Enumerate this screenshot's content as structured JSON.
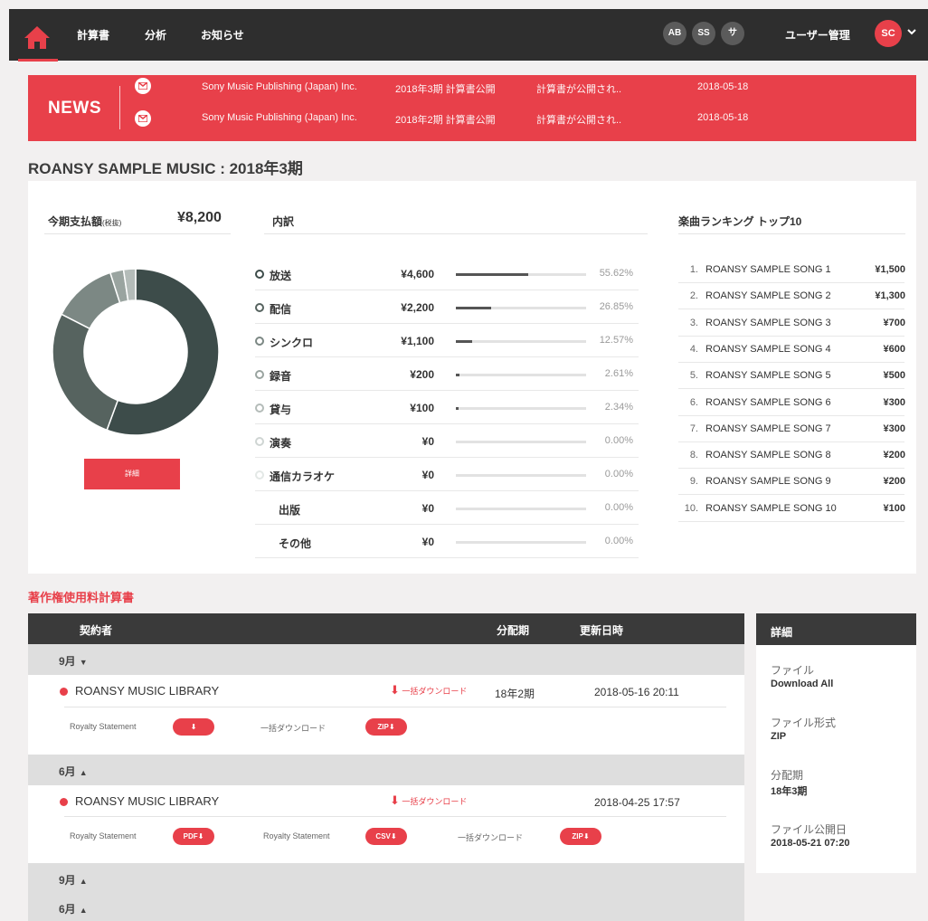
{
  "nav": {
    "items": [
      "計算書",
      "分析",
      "お知らせ"
    ],
    "avatars": [
      "AB",
      "SS",
      "サ"
    ],
    "user_management": "ユーザー管理",
    "user_initials": "SC"
  },
  "news": {
    "title": "NEWS",
    "items": [
      {
        "publisher": "Sony Music Publishing (Japan) Inc.",
        "event": "2018年3期 計算書公開",
        "message": "計算書が公開され..",
        "date": "2018-05-18"
      },
      {
        "publisher": "Sony Music Publishing (Japan) Inc.",
        "event": "2018年2期 計算書公開",
        "message": "計算書が公開され..",
        "date": "2018-05-18"
      }
    ]
  },
  "page_title": "ROANSY SAMPLE MUSIC : 2018年3期",
  "summary": {
    "payment_label": "今期支払額",
    "payment_tax_note": "(税抜)",
    "payment_amount": "¥8,200",
    "detail_button": "詳細",
    "breakdown_title": "内訳",
    "breakdown": [
      {
        "name": "放送",
        "amount": "¥4,600",
        "pct": "55.62%",
        "fraction": 0.5562,
        "color": "#3d4c4a"
      },
      {
        "name": "配信",
        "amount": "¥2,200",
        "pct": "26.85%",
        "fraction": 0.2685,
        "color": "#56635f"
      },
      {
        "name": "シンクロ",
        "amount": "¥1,100",
        "pct": "12.57%",
        "fraction": 0.1257,
        "color": "#7c8884"
      },
      {
        "name": "録音",
        "amount": "¥200",
        "pct": "2.61%",
        "fraction": 0.0261,
        "color": "#9aa4a0"
      },
      {
        "name": "貸与",
        "amount": "¥100",
        "pct": "2.34%",
        "fraction": 0.0234,
        "color": "#b4bcb9"
      },
      {
        "name": "演奏",
        "amount": "¥0",
        "pct": "0.00%",
        "fraction": 0,
        "color": "#cfd5d3"
      },
      {
        "name": "通信カラオケ",
        "amount": "¥0",
        "pct": "0.00%",
        "fraction": 0,
        "color": "#e3e8e6"
      },
      {
        "name": "出版",
        "amount": "¥0",
        "pct": "0.00%",
        "fraction": 0,
        "color": ""
      },
      {
        "name": "その他",
        "amount": "¥0",
        "pct": "0.00%",
        "fraction": 0,
        "color": ""
      }
    ],
    "ranking_title": "楽曲ランキング トップ10",
    "ranking": [
      {
        "rank": "1.",
        "name": "ROANSY SAMPLE SONG 1",
        "amount": "¥1,500"
      },
      {
        "rank": "2.",
        "name": "ROANSY SAMPLE SONG 2",
        "amount": "¥1,300"
      },
      {
        "rank": "3.",
        "name": "ROANSY SAMPLE SONG 3",
        "amount": "¥700"
      },
      {
        "rank": "4.",
        "name": "ROANSY SAMPLE SONG 4",
        "amount": "¥600"
      },
      {
        "rank": "5.",
        "name": "ROANSY SAMPLE SONG 5",
        "amount": "¥500"
      },
      {
        "rank": "6.",
        "name": "ROANSY SAMPLE SONG 6",
        "amount": "¥300"
      },
      {
        "rank": "7.",
        "name": "ROANSY SAMPLE SONG 7",
        "amount": "¥300"
      },
      {
        "rank": "8.",
        "name": "ROANSY SAMPLE SONG 8",
        "amount": "¥200"
      },
      {
        "rank": "9.",
        "name": "ROANSY SAMPLE SONG 9",
        "amount": "¥200"
      },
      {
        "rank": "10.",
        "name": "ROANSY SAMPLE SONG 10",
        "amount": "¥100"
      }
    ]
  },
  "statements": {
    "title": "著作権使用料計算書",
    "headers": {
      "contractor": "契約者",
      "period": "分配期",
      "updated": "更新日時"
    },
    "groups": [
      {
        "month": "9月",
        "chevron": "⌄"
      },
      {
        "month": "6月",
        "chevron": "^"
      },
      {
        "month": "9月",
        "chevron": "^"
      },
      {
        "month": "6月",
        "chevron": "^"
      }
    ],
    "entries": [
      {
        "name": "ROANSY MUSIC LIBRARY",
        "bulk_download": "一括ダウンロード",
        "period": "18年2期",
        "updated": "2018-05-16 20:11"
      },
      {
        "name": "ROANSY MUSIC LIBRARY",
        "bulk_download": "一括ダウンロード",
        "period": "",
        "updated": "2018-04-25 17:57"
      }
    ],
    "sub1": {
      "royalty_label": "Royalty Statement",
      "bulk_label": "一括ダウンロード",
      "zip": "ZIP"
    },
    "sub2": {
      "royalty_label_1": "Royalty Statement",
      "pdf": "PDF",
      "royalty_label_2": "Royalty Statement",
      "csv": "CSV",
      "bulk_label": "一括ダウンロード",
      "zip": "ZIP"
    }
  },
  "details": {
    "title": "詳細",
    "fields": [
      {
        "label": "ファイル",
        "value": "Download All"
      },
      {
        "label": "ファイル形式",
        "value": "ZIP"
      },
      {
        "label": "分配期",
        "value": "18年3期"
      },
      {
        "label": "ファイル公開日",
        "value": "2018-05-21 07:20"
      }
    ]
  },
  "colors": {
    "accent": "#e8404a",
    "dark": "#2e2e2e",
    "donut_main": "#3d4c4a"
  }
}
